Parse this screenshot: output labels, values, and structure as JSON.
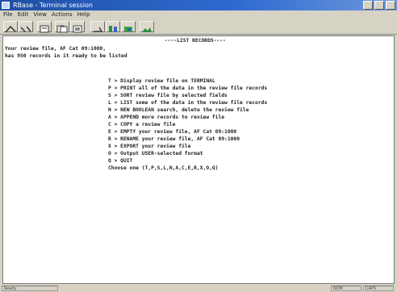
{
  "window": {
    "title": "RBase - Terminal session"
  },
  "menubar": {
    "items": [
      "File",
      "Edit",
      "View",
      "Actions",
      "Help"
    ]
  },
  "toolbar": {
    "buttons": [
      "connect",
      "disconnect",
      "print",
      "copy",
      "paste",
      "options",
      "help",
      "send",
      "receive",
      "image"
    ]
  },
  "terminal": {
    "header": "----LIST RECORDS----",
    "line1": "Your review file, AF Cat 09:1000,",
    "line2": "has 950 records in it ready to be listed",
    "options": [
      "T > Display review file on TERMINAL",
      "P > PRINT all of the data in the review file records",
      "S > SORT review file by selected fields",
      "L > LIST some of the data in the review file records",
      "N > NEW BOOLEAN search, delete the review file",
      "A > APPEND more records to review file",
      "C > COPY a review file",
      "E > EMPTY your review file, AF Cat 09:1000",
      "R > RENAME your review file, AF Cat 09:1000",
      "X > EXPORT your review file",
      "O > Output USER-selected format",
      "Q > QUIT"
    ],
    "prompt": "Choose one (T,P,S,L,N,A,C,E,R,X,O,Q)"
  },
  "statusbar": {
    "left": "Ready",
    "right1": "NUM",
    "right2": "CAPS"
  }
}
